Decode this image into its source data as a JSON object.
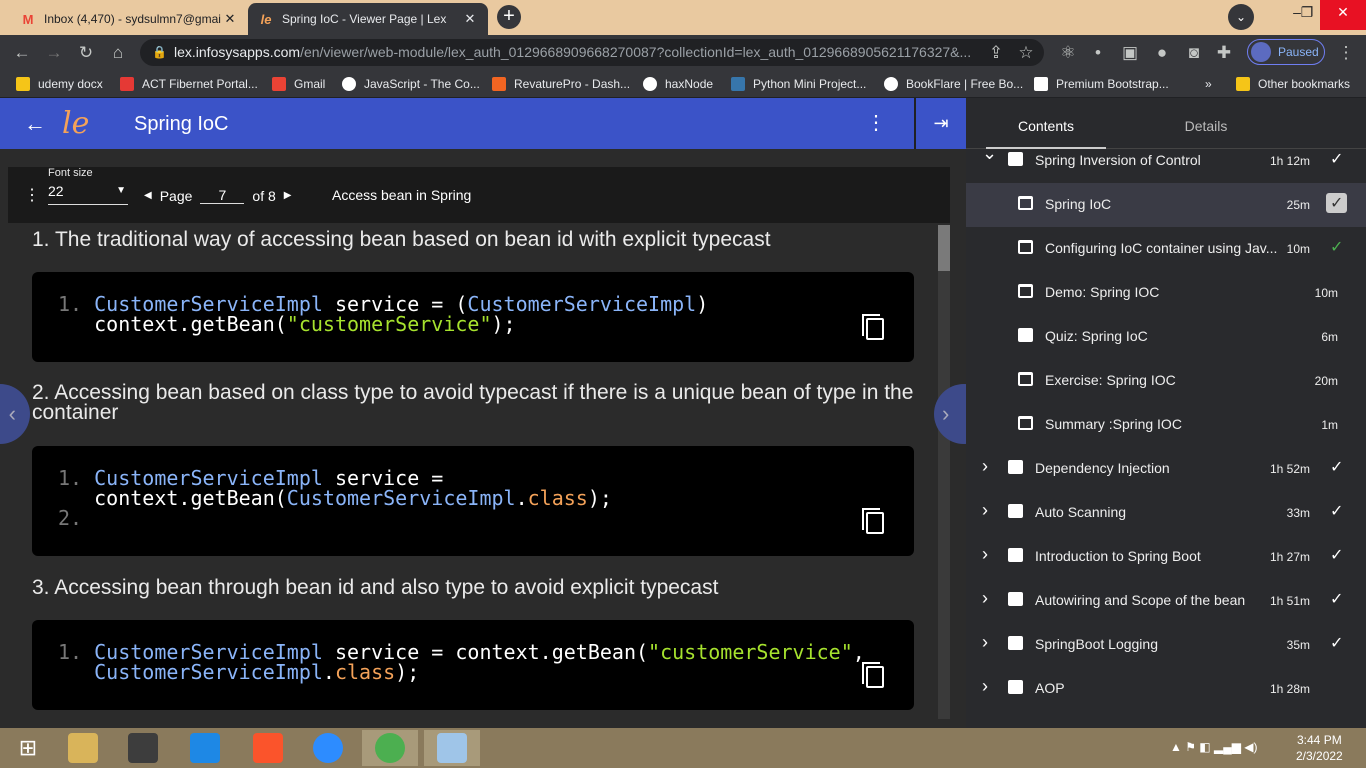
{
  "browser": {
    "tabs": [
      {
        "title": "Inbox (4,470) - sydsulmn7@gmai",
        "favicon": "gmail-icon",
        "active": false
      },
      {
        "title": "Spring IoC - Viewer Page | Lex",
        "favicon": "lex-icon",
        "active": true
      }
    ],
    "new_tab": "+",
    "url_main": "lex.infosysapps.com",
    "url_rest": "/en/viewer/web-module/lex_auth_0129668909668270087?collectionId=lex_auth_0129668905621176327&...",
    "profile_status": "Paused",
    "bookmarks": [
      {
        "label": "udemy docx",
        "color": "#f5c518"
      },
      {
        "label": "ACT Fibernet Portal...",
        "color": "#e53935"
      },
      {
        "label": "Gmail",
        "color": "#ea4335"
      },
      {
        "label": "JavaScript - The Co...",
        "color": "#ffffff"
      },
      {
        "label": "RevaturePro - Dash...",
        "color": "#f26522"
      },
      {
        "label": "haxNode",
        "color": "#ffffff"
      },
      {
        "label": "Python Mini Project...",
        "color": "#3776ab"
      },
      {
        "label": "BookFlare | Free Bo...",
        "color": "#ffffff"
      },
      {
        "label": "Premium Bootstrap...",
        "color": "#ffffff"
      }
    ],
    "bookmarks_more": "»",
    "other_bookmarks": "Other bookmarks"
  },
  "app": {
    "title": "Spring IoC",
    "logo_text": "le",
    "logo_accent": "#f4a259"
  },
  "viewer": {
    "font_size_label": "Font size",
    "font_size_value": "22",
    "page_label": "Page",
    "page_value": "7",
    "page_total": "of 8",
    "section_title": "Access bean in Spring",
    "para1": "1. The traditional way of accessing bean based on bean id with explicit typecast",
    "para2": "2. Accessing bean based on class type to avoid typecast if there is a unique bean of type in the container",
    "para3": "3. Accessing bean through bean id and also type to avoid explicit typecast",
    "code1": {
      "ln1": "1.",
      "class_a": "CustomerServiceImpl",
      "t1": " service = (",
      "class_b": "CustomerServiceImpl",
      "t2": ")",
      "line2a": "context.getBean(",
      "str": "\"customerService\"",
      "line2b": ");"
    },
    "code2": {
      "ln1": "1.",
      "ln2": "2.",
      "class_a": "CustomerServiceImpl",
      "t1": " service =",
      "line2a": "context.getBean(",
      "class_b": "CustomerServiceImpl",
      "dot": ".",
      "kw": "class",
      "line2b": ");"
    },
    "code3": {
      "ln1": "1.",
      "class_a": "CustomerServiceImpl",
      "t1": " service = context.getBean(",
      "str": "\"customerService\"",
      "comma": ",",
      "class_b": "CustomerServiceImpl",
      "dot": ".",
      "kw": "class",
      "t2": ");"
    }
  },
  "sidebar": {
    "tab_contents": "Contents",
    "tab_details": "Details",
    "items": [
      {
        "label": "Spring Inversion of Control",
        "duration": "1h 12m",
        "type": "folder",
        "expanded": true,
        "done": true
      },
      {
        "label": "Spring IoC",
        "duration": "25m",
        "type": "doc",
        "selected": true,
        "done": true
      },
      {
        "label": "Configuring IoC container using Jav...",
        "duration": "10m",
        "type": "doc",
        "done": true
      },
      {
        "label": "Demo: Spring IOC",
        "duration": "10m",
        "type": "doc"
      },
      {
        "label": "Quiz: Spring IoC",
        "duration": "6m",
        "type": "quiz"
      },
      {
        "label": "Exercise: Spring IOC",
        "duration": "20m",
        "type": "doc"
      },
      {
        "label": "Summary :Spring IOC",
        "duration": "1m",
        "type": "doc"
      },
      {
        "label": "Dependency Injection",
        "duration": "1h 52m",
        "type": "folder",
        "done": true
      },
      {
        "label": "Auto Scanning",
        "duration": "33m",
        "type": "folder",
        "done": true
      },
      {
        "label": "Introduction to Spring Boot",
        "duration": "1h 27m",
        "type": "folder",
        "done": true
      },
      {
        "label": "Autowiring and Scope of the bean",
        "duration": "1h 51m",
        "type": "folder",
        "done": true
      },
      {
        "label": "SpringBoot Logging",
        "duration": "35m",
        "type": "folder",
        "done": true
      },
      {
        "label": "AOP",
        "duration": "1h 28m",
        "type": "folder"
      }
    ]
  },
  "taskbar": {
    "time": "3:44 PM",
    "date": "2/3/2022"
  }
}
